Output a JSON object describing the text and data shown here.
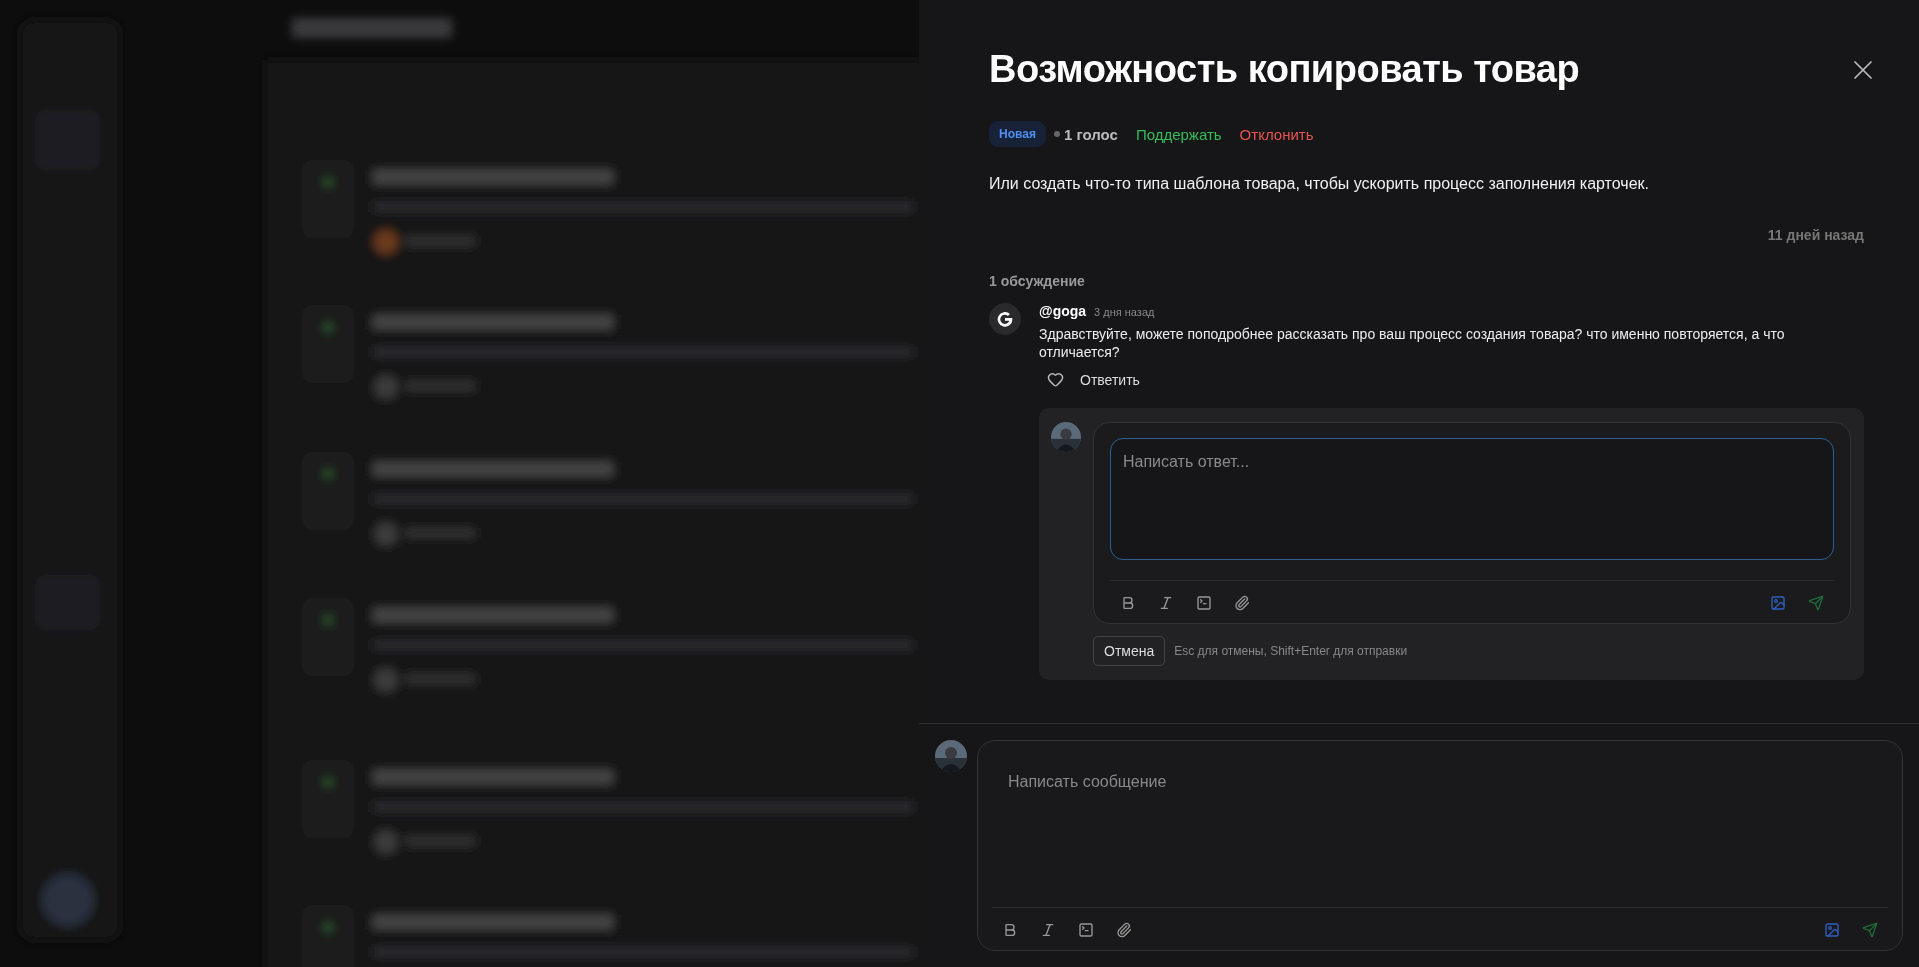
{
  "idea": {
    "title": "Возможность копировать товар",
    "status": {
      "label": "Новая",
      "kind": "new"
    },
    "votes": "1 голос",
    "actions": [
      {
        "label": "Поддержать",
        "kind": "support"
      },
      {
        "label": "Отклонить",
        "kind": "reject"
      }
    ],
    "description": "Или создать что-то типа шаблона товара, чтобы ускорить процесс заполнения карточек.",
    "date": "11 дней назад"
  },
  "discussion": {
    "count": "1 обсуждение",
    "comments": [
      {
        "author": "@goga",
        "time": "3 дня назад",
        "text": "Здравствуйте, можете поподробнее рассказать про ваш процесс создания товара? что именно повторяется, а что отличается?",
        "liked": false,
        "reply": "Ответить"
      }
    ]
  },
  "reply_form": {
    "placeholder": "Написать ответ...",
    "focused": true,
    "cancel": "Отмена",
    "hint": "Esc для отмены, Shift+Enter для отправки"
  },
  "composer": {
    "placeholder": "Написать сообщение",
    "focused": false
  }
}
